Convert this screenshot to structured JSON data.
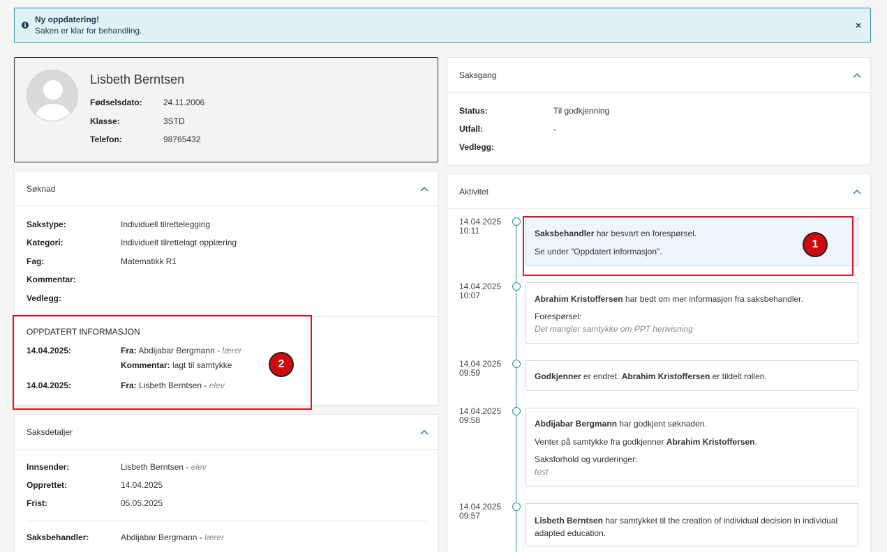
{
  "alert": {
    "title": "Ny oppdatering!",
    "text": "Saken er klar for behandling.",
    "close": "×"
  },
  "profile": {
    "name": "Lisbeth Berntsen",
    "fields": [
      {
        "label": "Fødselsdato:",
        "value": "24.11.2006"
      },
      {
        "label": "Klasse:",
        "value": "3STD"
      },
      {
        "label": "Telefon:",
        "value": "98765432"
      }
    ]
  },
  "soknad": {
    "title": "Søknad",
    "fields": [
      {
        "label": "Sakstype:",
        "value": "Individuell tilrettelegging"
      },
      {
        "label": "Kategori:",
        "value": "Individuelt tilrettelagt opplæring"
      },
      {
        "label": "Fag:",
        "value": "Matematikk R1"
      },
      {
        "label": "Kommentar:",
        "value": ""
      },
      {
        "label": "Vedlegg:",
        "value": ""
      }
    ],
    "updated_title": "OPPDATERT INFORMASJON",
    "updates": [
      {
        "date": "14.04.2025:",
        "from_label": "Fra:",
        "from_name": "Abdijabar Bergmann",
        "sep": " - ",
        "role": "lærer",
        "comment_label": "Kommentar:",
        "comment": "lagt til samtykke"
      },
      {
        "date": "14.04.2025:",
        "from_label": "Fra:",
        "from_name": "Lisbeth Berntsen",
        "sep": " - ",
        "role": "elev"
      }
    ]
  },
  "saksdetaljer": {
    "title": "Saksdetaljer",
    "fields": [
      {
        "label": "Innsender:",
        "value": "Lisbeth Berntsen",
        "sep": " - ",
        "role": "elev"
      },
      {
        "label": "Opprettet:",
        "value": "14.04.2025"
      },
      {
        "label": "Frist:",
        "value": "05.05.2025"
      },
      {
        "label": "Saksbehandler:",
        "value": "Abdijabar Bergmann",
        "sep": " - ",
        "role": "lærer"
      }
    ]
  },
  "saksgang": {
    "title": "Saksgang",
    "fields": [
      {
        "label": "Status:",
        "value": "Til godkjenning"
      },
      {
        "label": "Utfall:",
        "value": "-"
      },
      {
        "label": "Vedlegg:",
        "value": ""
      }
    ]
  },
  "aktivitet": {
    "title": "Aktivitet",
    "items": [
      {
        "date": "14.04.2025",
        "time": "10:11",
        "actor": "Saksbehandler",
        "text": " har besvart en forespørsel.",
        "line2": "Se under \"Oppdatert informasjon\"."
      },
      {
        "date": "14.04.2025",
        "time": "10:07",
        "actor": "Abrahim Kristoffersen",
        "text": " har bedt om mer informasjon fra saksbehandler.",
        "sub_label": "Forespørsel:",
        "sub_text": "Det mangler samtykke om PPT henvisning"
      },
      {
        "date": "14.04.2025",
        "time": "09:59",
        "actor": "Godkjenner",
        "text": " er endret. ",
        "actor2": "Abrahim Kristoffersen",
        "text2": " er tildelt rollen."
      },
      {
        "date": "14.04.2025",
        "time": "09:58",
        "actor": "Abdijabar Bergmann",
        "text": " har godkjent søknaden.",
        "line2_pre": "Venter på samtykke fra godkjenner ",
        "line2_actor": "Abrahim Kristoffersen",
        "line2_post": ".",
        "sub_label": "Saksforhold og vurderinger:",
        "sub_text": "test"
      },
      {
        "date": "14.04.2025",
        "time": "09:57",
        "actor": "Lisbeth Berntsen",
        "text": " har samtykket til the creation of individual decision in individual adapted education."
      }
    ]
  },
  "badges": {
    "one": "1",
    "two": "2"
  },
  "colors": {
    "accent": "#2a8fa3",
    "alert_bg": "#dff3f6",
    "highlight": "#e3141b"
  }
}
